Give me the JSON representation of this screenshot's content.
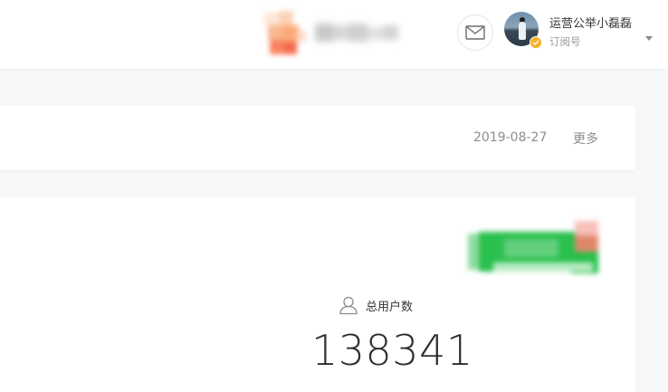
{
  "header": {
    "account": {
      "name": "运营公举小磊磊",
      "type": "订阅号"
    },
    "icons": {
      "mail": "mail-icon",
      "verified": "verified-badge-icon",
      "caret": "caret-down-icon"
    }
  },
  "article_card": {
    "date": "2019-08-27",
    "more_label": "更多"
  },
  "stats_card": {
    "total_users_label": "总用户数",
    "total_users_value": "138341",
    "user_icon": "user-icon"
  },
  "colors": {
    "page_bg": "#f6f7f9",
    "card_bg": "#ffffff",
    "brand_green": "#1aad19",
    "verified_orange": "#f5b029"
  }
}
